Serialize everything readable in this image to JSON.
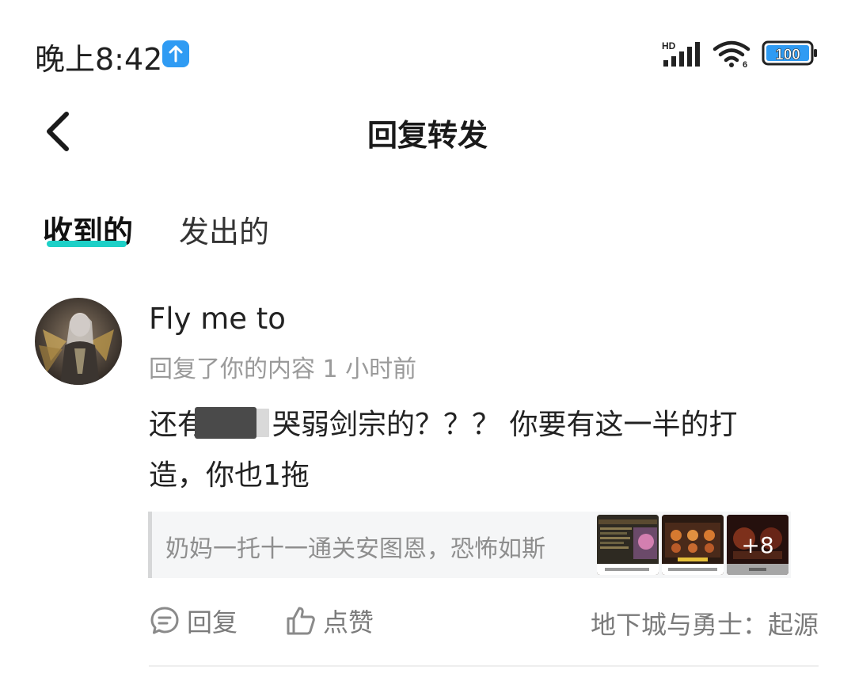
{
  "status_bar": {
    "time": "晚上8:42",
    "battery_level": "100",
    "network": "HD",
    "wifi_label": "6"
  },
  "header": {
    "title": "回复转发"
  },
  "tabs": [
    {
      "label": "收到的",
      "active": true
    },
    {
      "label": "发出的",
      "active": false
    }
  ],
  "reply": {
    "username": "Fly me to",
    "meta": "回复了你的内容 1 小时前",
    "text_line1_a": "还有",
    "text_line1_b": "哭弱剑宗的？？？ 你要有这一半的打",
    "text_line2": "造，你也1拖",
    "quote": {
      "text": "奶妈一托十一通关安图恩，恐怖如斯",
      "more_images": "+8"
    },
    "actions": {
      "reply_label": "回复",
      "like_label": "点赞"
    },
    "game_tag": "地下城与勇士：起源"
  },
  "colors": {
    "accent": "#1dd0c7",
    "upload_badge": "#2f9bf3",
    "battery_fill": "#2f9bf3"
  }
}
